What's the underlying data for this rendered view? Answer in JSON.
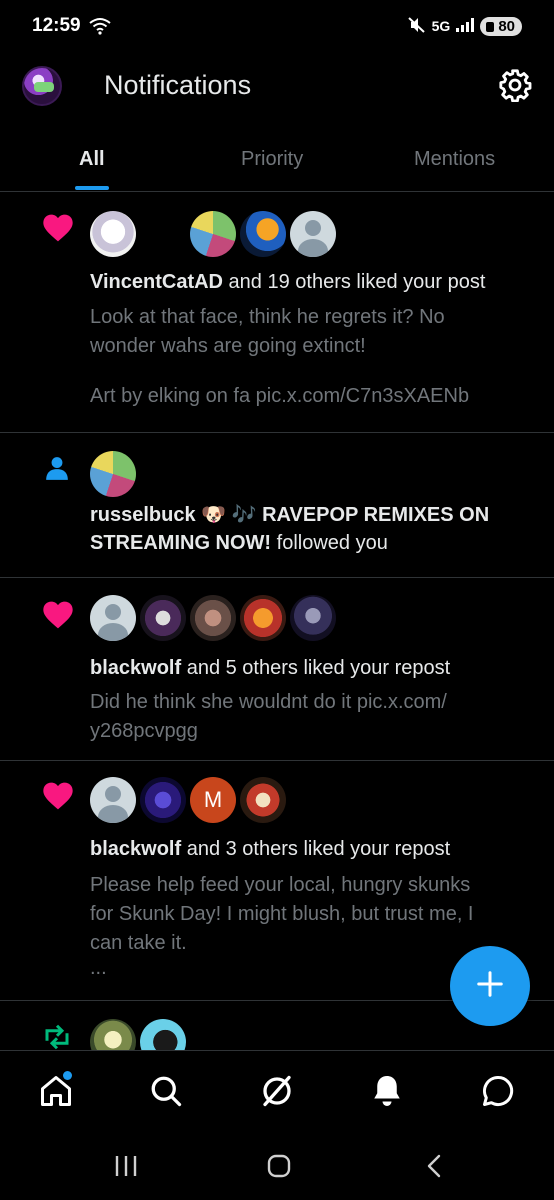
{
  "status_bar": {
    "time": "12:59",
    "network": "5G",
    "battery": "80"
  },
  "header": {
    "title": "Notifications"
  },
  "tabs": [
    {
      "label": "All",
      "active": true
    },
    {
      "label": "Priority",
      "active": false
    },
    {
      "label": "Mentions",
      "active": false
    }
  ],
  "notifications": [
    {
      "type": "like",
      "user": "VincentCatAD",
      "action": " and 19 others liked your post",
      "preview_line1": "Look at that face, think he regrets it? No",
      "preview_line2": "wonder wahs are going extinct!",
      "preview_line3": "Art by elking on fa pic.x.com/C7n3sXAENb"
    },
    {
      "type": "follow",
      "user": "russelbuck 🐶 🎶 RAVEPOP REMIXES ON",
      "user_line2": "STREAMING NOW!",
      "action": " followed you"
    },
    {
      "type": "like",
      "user": "blackwolf",
      "action": " and 5 others liked your repost",
      "preview_line1": "Did he think she wouldnt do it pic.x.com/",
      "preview_line2": "y268pcvpgg"
    },
    {
      "type": "like",
      "user": "blackwolf",
      "action": " and 3 others liked your repost",
      "avatar_letter": "M",
      "preview_line1": "Please help feed your local, hungry skunks",
      "preview_line2": "for Skunk Day!  I might blush, but trust me, I",
      "preview_line3": "can take it.",
      "preview_line4": "..."
    },
    {
      "type": "repost"
    }
  ],
  "colors": {
    "accent": "#1d9bf0",
    "like": "#f91880",
    "repost": "#00ba7c",
    "secondary_text": "#71767b"
  },
  "icons": [
    "gear-icon",
    "heart-icon",
    "person-icon",
    "repost-icon",
    "plus-icon",
    "home-icon",
    "search-icon",
    "grok-icon",
    "bell-icon",
    "chat-icon"
  ]
}
